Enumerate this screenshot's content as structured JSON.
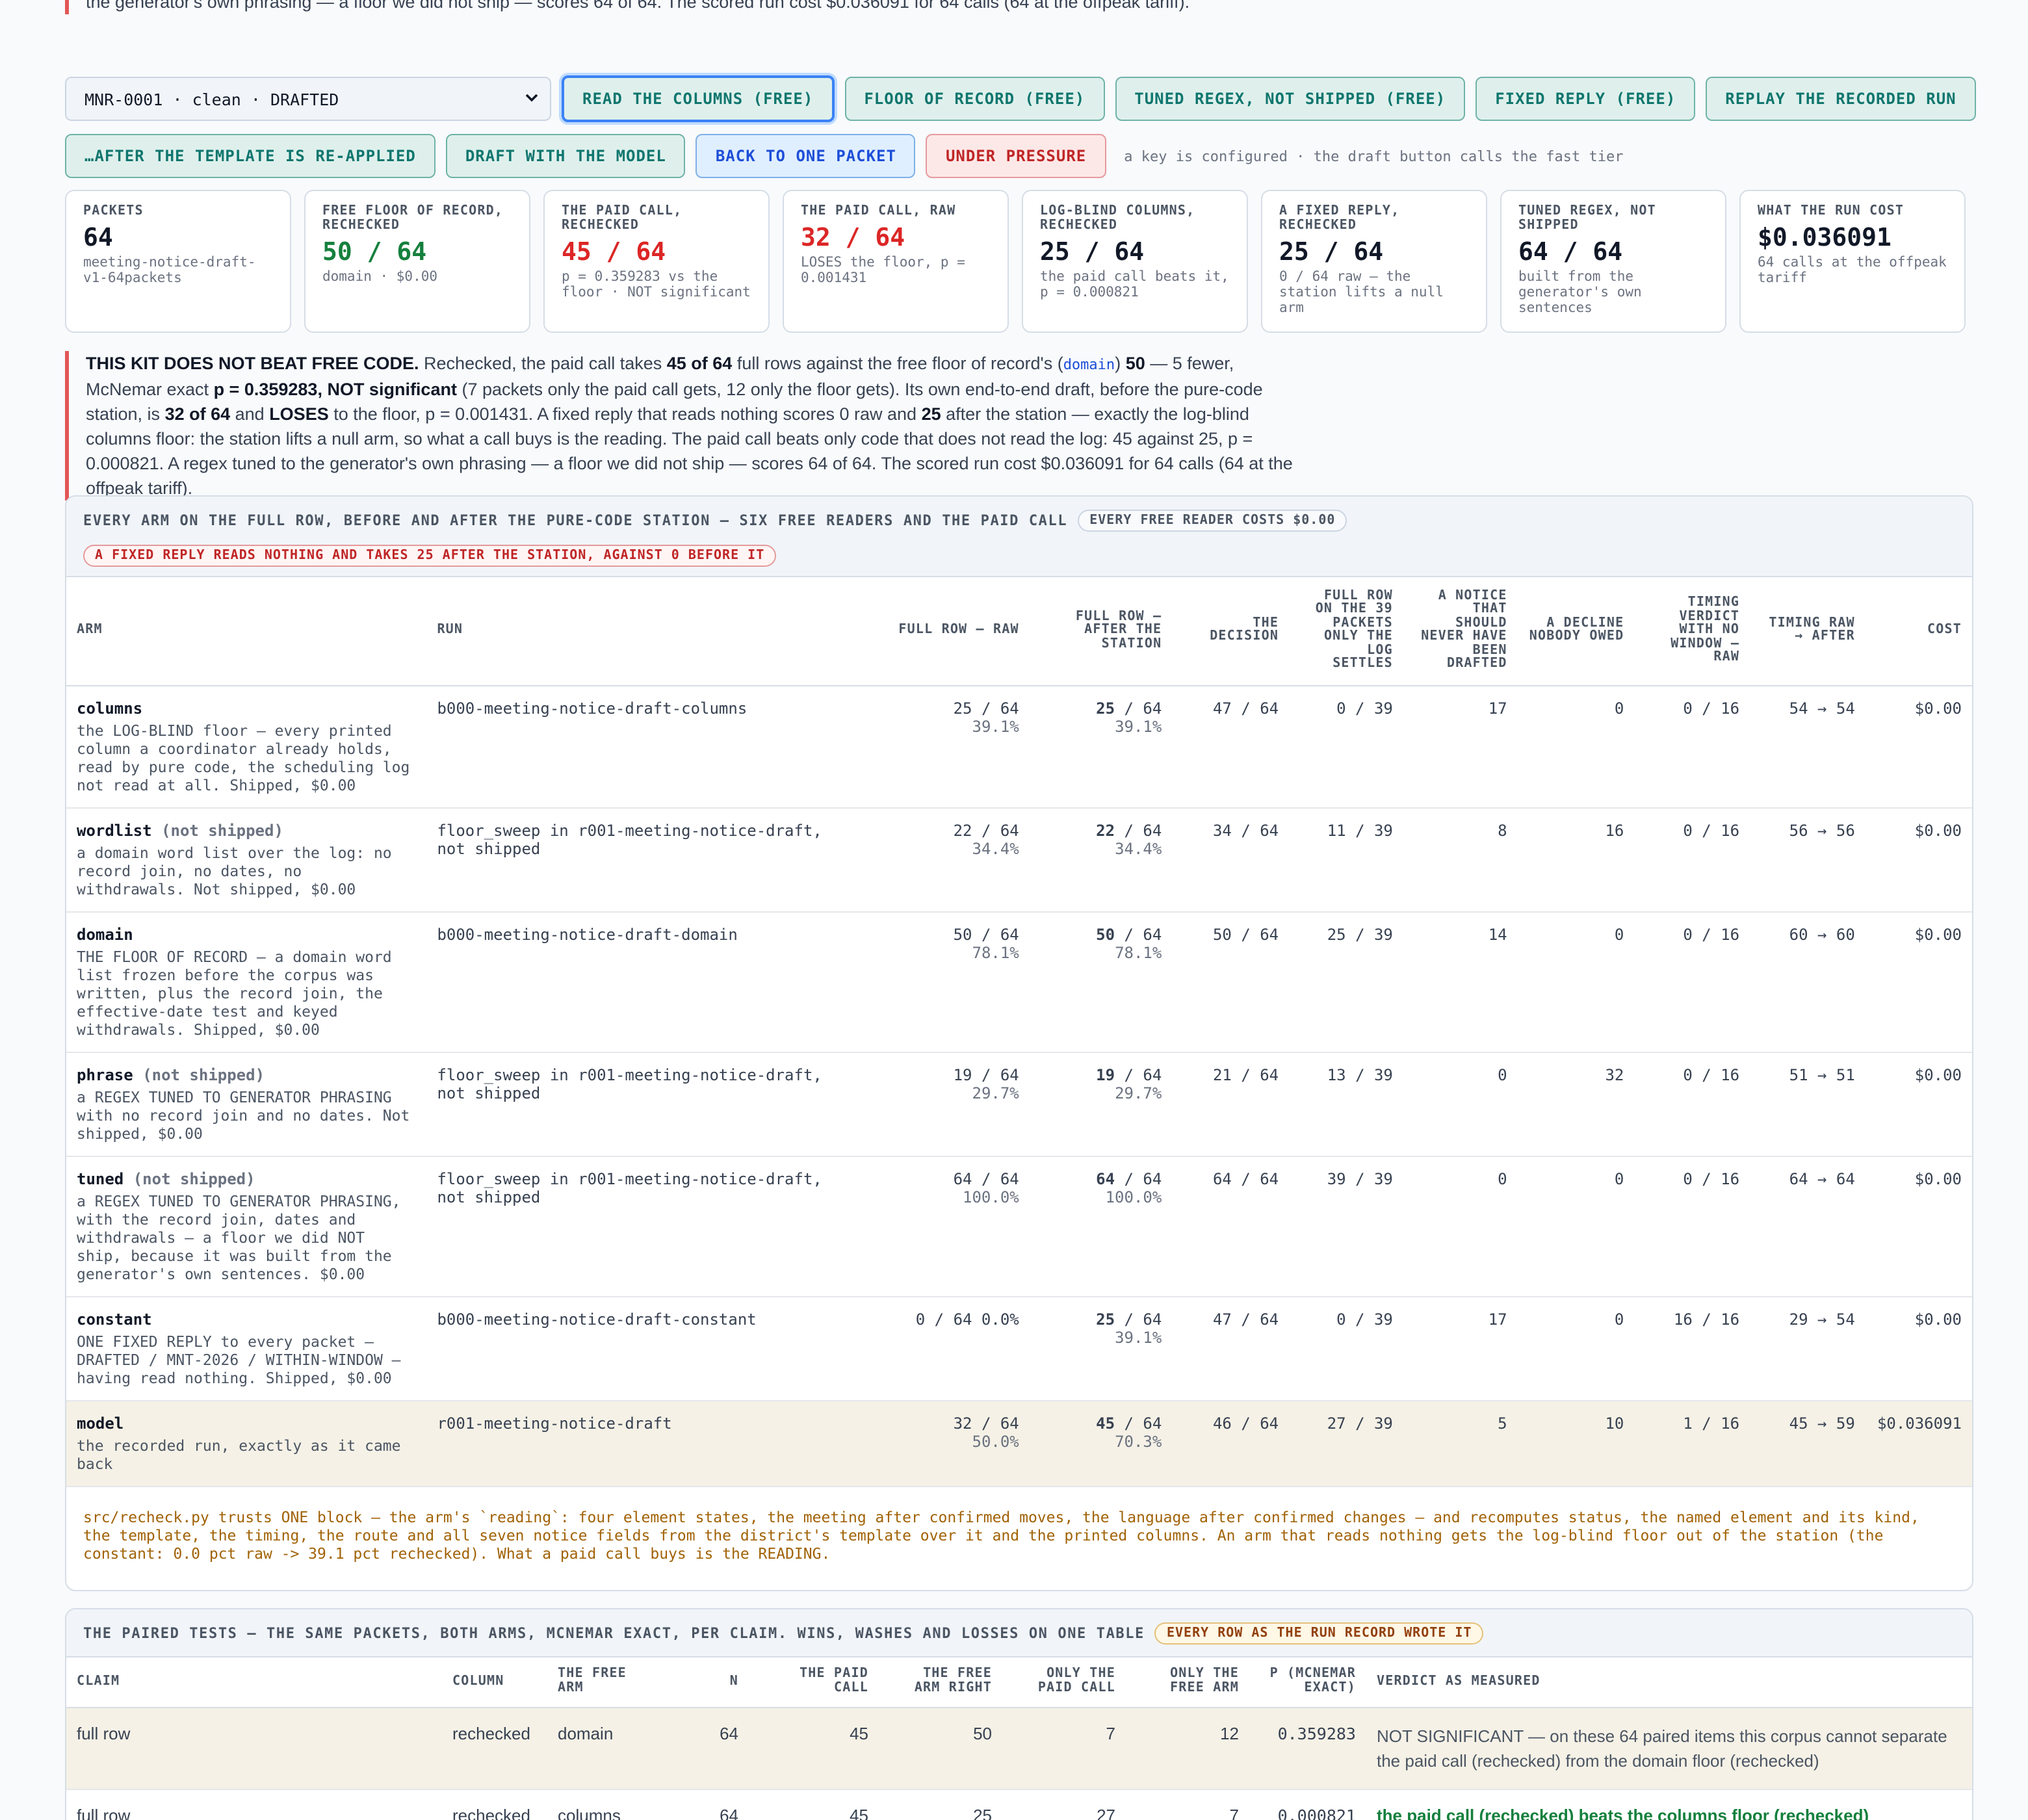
{
  "top_callout": "the generator's own phrasing — a floor we did not ship — scores 64 of 64. The scored run cost $0.036091 for 64 calls (64 at the offpeak tariff).",
  "selector": {
    "value": "MNR-0001 · clean · DRAFTED"
  },
  "buttons": [
    "READ THE COLUMNS (FREE)",
    "FLOOR OF RECORD (FREE)",
    "TUNED REGEX, NOT SHIPPED (FREE)",
    "FIXED REPLY (FREE)",
    "REPLAY THE RECORDED RUN",
    "…AFTER THE TEMPLATE IS RE-APPLIED",
    "DRAFT WITH THE MODEL",
    "BACK TO ONE PACKET",
    "UNDER PRESSURE"
  ],
  "key_note": "a key is configured · the draft button calls the fast tier",
  "cards": [
    {
      "label": "PACKETS",
      "value": "64",
      "sub": "meeting-notice-draft-v1-64packets"
    },
    {
      "label": "FREE FLOOR OF RECORD, RECHECKED",
      "value": "50 / 64",
      "sub": "domain · $0.00"
    },
    {
      "label": "THE PAID CALL, RECHECKED",
      "value": "45 / 64",
      "sub": "p = 0.359283 vs the floor · NOT significant"
    },
    {
      "label": "THE PAID CALL, RAW",
      "value": "32 / 64",
      "sub": "LOSES the floor, p = 0.001431"
    },
    {
      "label": "LOG-BLIND COLUMNS, RECHECKED",
      "value": "25 / 64",
      "sub": "the paid call beats it, p = 0.000821"
    },
    {
      "label": "A FIXED REPLY, RECHECKED",
      "value": "25 / 64",
      "sub": "0 / 64 raw — the station lifts a null arm"
    },
    {
      "label": "TUNED REGEX, NOT SHIPPED",
      "value": "64 / 64",
      "sub": "built from the generator's own sentences"
    },
    {
      "label": "WHAT THE RUN COST",
      "value": "$0.036091",
      "sub": "64 calls at the offpeak tariff"
    }
  ],
  "callout": {
    "lead": "THIS KIT DOES NOT BEAT FREE CODE.",
    "t1": " Rechecked, the paid call takes ",
    "b1": "45 of 64",
    "t2": " full rows against the free floor of record's (",
    "code": "domain",
    "t3": ") ",
    "b2": "50",
    "t4": " — 5 fewer, McNemar exact ",
    "b3": "p = 0.359283, NOT significant",
    "t5": " (7 packets only the paid call gets, 12 only the floor gets). Its own end-to-end draft, before the pure-code station, is ",
    "b4": "32 of 64",
    "t6": " and ",
    "b5": "LOSES",
    "t7": " to the floor, p = 0.001431. A fixed reply that reads nothing scores 0 raw and ",
    "b6": "25",
    "t8": " after the station — exactly the log-blind columns floor: the station lifts a null arm, so what a call buys is the reading. The paid call beats only code that does not read the log: 45 against 25, p = 0.000821. A regex tuned to the generator's own phrasing — a floor we did not ship — scores 64 of 64. The scored run cost $0.036091 for 64 calls (64 at the offpeak tariff)."
  },
  "panel1": {
    "title": "EVERY ARM ON THE FULL ROW, BEFORE AND AFTER THE PURE-CODE STATION — SIX FREE READERS AND THE PAID CALL",
    "pill": "EVERY FREE READER COSTS $0.00",
    "pill2": "A FIXED REPLY READS NOTHING AND TAKES 25 AFTER THE STATION, AGAINST 0 BEFORE IT",
    "headers": [
      "ARM",
      "RUN",
      "FULL ROW — RAW",
      "FULL ROW — AFTER THE STATION",
      "THE DECISION",
      "FULL ROW ON THE 39 PACKETS ONLY THE LOG SETTLES",
      "A NOTICE THAT SHOULD NEVER HAVE BEEN DRAFTED",
      "A DECLINE NOBODY OWED",
      "TIMING VERDICT WITH NO WINDOW — RAW",
      "TIMING RAW → AFTER",
      "COST"
    ],
    "rows": [
      {
        "name": "columns",
        "tag": "",
        "desc": "the LOG-BLIND floor — every printed column a coordinator already holds, read by pure code, the scheduling log not read at all. Shipped, $0.00",
        "run": "b000-meeting-notice-draft-columns",
        "raw": "25 / 64",
        "raw_pct": "39.1%",
        "after_n": "25",
        "after_d": " / 64",
        "after_pct": "39.1%",
        "decision": "47 / 64",
        "log": "0 / 39",
        "never": "17",
        "decline": "0",
        "timing": "0 / 16",
        "timing_ra": "54 → 54",
        "cost": "$0.00"
      },
      {
        "name": "wordlist",
        "tag": "(not shipped)",
        "desc": "a domain word list over the log: no record join, no dates, no withdrawals. Not shipped, $0.00",
        "run": "floor_sweep in r001-meeting-notice-draft, not shipped",
        "raw": "22 / 64",
        "raw_pct": "34.4%",
        "after_n": "22",
        "after_d": " / 64",
        "after_pct": "34.4%",
        "decision": "34 / 64",
        "log": "11 / 39",
        "never": "8",
        "decline": "16",
        "timing": "0 / 16",
        "timing_ra": "56 → 56",
        "cost": "$0.00"
      },
      {
        "name": "domain",
        "tag": "",
        "desc": "THE FLOOR OF RECORD — a domain word list frozen before the corpus was written, plus the record join, the effective-date test and keyed withdrawals. Shipped, $0.00",
        "run": "b000-meeting-notice-draft-domain",
        "raw": "50 / 64",
        "raw_pct": "78.1%",
        "after_n": "50",
        "after_d": " / 64",
        "after_pct": "78.1%",
        "decision": "50 / 64",
        "log": "25 / 39",
        "never": "14",
        "decline": "0",
        "timing": "0 / 16",
        "timing_ra": "60 → 60",
        "cost": "$0.00"
      },
      {
        "name": "phrase",
        "tag": "(not shipped)",
        "desc": "a REGEX TUNED TO GENERATOR PHRASING with no record join and no dates. Not shipped, $0.00",
        "run": "floor_sweep in r001-meeting-notice-draft, not shipped",
        "raw": "19 / 64",
        "raw_pct": "29.7%",
        "after_n": "19",
        "after_d": " / 64",
        "after_pct": "29.7%",
        "decision": "21 / 64",
        "log": "13 / 39",
        "never": "0",
        "decline": "32",
        "timing": "0 / 16",
        "timing_ra": "51 → 51",
        "cost": "$0.00"
      },
      {
        "name": "tuned",
        "tag": "(not shipped)",
        "desc": "a REGEX TUNED TO GENERATOR PHRASING, with the record join, dates and withdrawals — a floor we did NOT ship, because it was built from the generator's own sentences. $0.00",
        "run": "floor_sweep in r001-meeting-notice-draft, not shipped",
        "raw": "64 / 64",
        "raw_pct": "100.0%",
        "after_n": "64",
        "after_d": " / 64",
        "after_pct": "100.0%",
        "decision": "64 / 64",
        "log": "39 / 39",
        "never": "0",
        "decline": "0",
        "timing": "0 / 16",
        "timing_ra": "64 → 64",
        "cost": "$0.00"
      },
      {
        "name": "constant",
        "tag": "",
        "desc": "ONE FIXED REPLY to every packet — DRAFTED / MNT-2026 / WITHIN-WINDOW — having read nothing. Shipped, $0.00",
        "run": "b000-meeting-notice-draft-constant",
        "raw": "0 / 64 0.0%",
        "raw_pct": "",
        "after_n": "25",
        "after_d": " / 64",
        "after_pct": "39.1%",
        "decision": "47 / 64",
        "log": "0 / 39",
        "never": "17",
        "decline": "0",
        "timing": "16 / 16",
        "timing_ra": "29 → 54",
        "cost": "$0.00"
      },
      {
        "name": "model",
        "tag": "",
        "desc": "the recorded run, exactly as it came back",
        "run": "r001-meeting-notice-draft",
        "raw": "32 / 64",
        "raw_pct": "50.0%",
        "after_n": "45",
        "after_d": " / 64",
        "after_pct": "70.3%",
        "decision": "46 / 64",
        "log": "27 / 39",
        "never": "5",
        "decline": "10",
        "timing": "1 / 16",
        "timing_ra": "45 → 59",
        "cost": "$0.036091"
      }
    ],
    "footnote": "src/recheck.py trusts ONE block — the arm's `reading`: four element states, the meeting after confirmed moves, the language after confirmed changes — and recomputes status, the named element and its kind, the template, the timing, the route and all seven notice fields from the district's template over it and the printed columns. An arm that reads nothing gets the log-blind floor out of the station (the constant: 0.0 pct raw -> 39.1 pct rechecked). What a paid call buys is the READING."
  },
  "panel2": {
    "title": "THE PAIRED TESTS — THE SAME PACKETS, BOTH ARMS, MCNEMAR EXACT, PER CLAIM. WINS, WASHES AND LOSSES ON ONE TABLE",
    "pill": "EVERY ROW AS THE RUN RECORD WROTE IT",
    "headers": [
      "CLAIM",
      "COLUMN",
      "THE FREE ARM",
      "N",
      "THE PAID CALL",
      "THE FREE ARM RIGHT",
      "ONLY THE PAID CALL",
      "ONLY THE FREE ARM",
      "P (MCNEMAR EXACT)",
      "VERDICT AS MEASURED"
    ],
    "rows": [
      {
        "claim": "full row",
        "column": "rechecked",
        "arm": "domain",
        "n": "64",
        "paid": "45",
        "free": "50",
        "only_paid": "7",
        "only_free": "12",
        "p": "0.359283",
        "verdict": "NOT SIGNIFICANT — on these 64 paired items this corpus cannot separate the paid call (rechecked) from the domain floor (rechecked)",
        "win": false
      },
      {
        "claim": "full row",
        "column": "rechecked",
        "arm": "columns",
        "n": "64",
        "paid": "45",
        "free": "25",
        "only_paid": "27",
        "only_free": "7",
        "p": "0.000821",
        "verdict": "the paid call (rechecked) beats the columns floor (rechecked)",
        "win": true
      }
    ]
  },
  "colors": {
    "accent": "#0f766e",
    "warning": "#e25757",
    "win": "#15803d",
    "loss": "#dc2626"
  }
}
